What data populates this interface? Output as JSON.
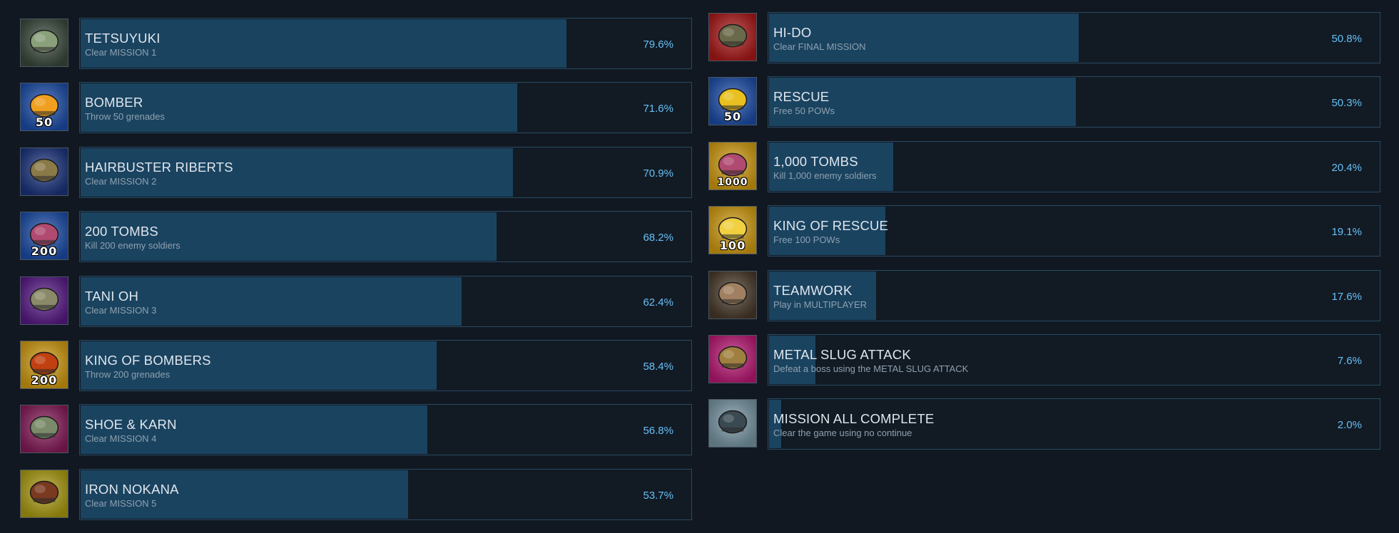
{
  "achievements_left": [
    {
      "name": "TETSUYUKI",
      "desc": "Clear MISSION 1",
      "pct_label": "79.6%",
      "pct": 79.6,
      "icon": "tetsuyuki-icon",
      "icon_bg": "#3a4a3c",
      "icon_fg": "#8aa07a"
    },
    {
      "name": "BOMBER",
      "desc": "Throw 50 grenades",
      "pct_label": "71.6%",
      "pct": 71.6,
      "icon": "bomber-50-icon",
      "icon_bg": "#1c4fae",
      "icon_fg": "#f0a020",
      "badge": "50"
    },
    {
      "name": "HAIRBUSTER RIBERTS",
      "desc": "Clear MISSION 2",
      "pct_label": "70.9%",
      "pct": 70.9,
      "icon": "hairbuster-riberts-icon",
      "icon_bg": "#1a3480",
      "icon_fg": "#8a7a48"
    },
    {
      "name": "200 TOMBS",
      "desc": "Kill 200 enemy soldiers",
      "pct_label": "68.2%",
      "pct": 68.2,
      "icon": "tombs-200-icon",
      "icon_bg": "#1c4fae",
      "icon_fg": "#b04a70",
      "badge": "200"
    },
    {
      "name": "TANI OH",
      "desc": "Clear MISSION 3",
      "pct_label": "62.4%",
      "pct": 62.4,
      "icon": "tani-oh-icon",
      "icon_bg": "#5a1a8a",
      "icon_fg": "#8a8a6a"
    },
    {
      "name": "KING OF BOMBERS",
      "desc": "Throw 200 grenades",
      "pct_label": "58.4%",
      "pct": 58.4,
      "icon": "king-of-bombers-icon",
      "icon_bg": "#d8a010",
      "icon_fg": "#c04010",
      "badge": "200"
    },
    {
      "name": "SHOE & KARN",
      "desc": "Clear MISSION 4",
      "pct_label": "56.8%",
      "pct": 56.8,
      "icon": "shoe-and-karn-icon",
      "icon_bg": "#8a1a5a",
      "icon_fg": "#7a8a6a"
    },
    {
      "name": "IRON NOKANA",
      "desc": "Clear MISSION 5",
      "pct_label": "53.7%",
      "pct": 53.7,
      "icon": "iron-nokana-icon",
      "icon_bg": "#b0a010",
      "icon_fg": "#7a3a20"
    }
  ],
  "achievements_right": [
    {
      "name": "HI-DO",
      "desc": "Clear FINAL MISSION",
      "pct_label": "50.8%",
      "pct": 50.8,
      "icon": "hi-do-icon",
      "icon_bg": "#b01818",
      "icon_fg": "#6a6a4a"
    },
    {
      "name": "RESCUE",
      "desc": "Free 50 POWs",
      "pct_label": "50.3%",
      "pct": 50.3,
      "icon": "rescue-50-icon",
      "icon_bg": "#1c4fae",
      "icon_fg": "#e8c020",
      "badge": "50"
    },
    {
      "name": "1,000 TOMBS",
      "desc": "Kill 1,000 enemy soldiers",
      "pct_label": "20.4%",
      "pct": 20.4,
      "icon": "tombs-1000-icon",
      "icon_bg": "#d8a010",
      "icon_fg": "#b04a70",
      "badge": "1000"
    },
    {
      "name": "KING OF RESCUE",
      "desc": "Free 100 POWs",
      "pct_label": "19.1%",
      "pct": 19.1,
      "icon": "king-of-rescue-icon",
      "icon_bg": "#d8a010",
      "icon_fg": "#f0d040",
      "badge": "100"
    },
    {
      "name": "TEAMWORK",
      "desc": "Play in MULTIPLAYER",
      "pct_label": "17.6%",
      "pct": 17.6,
      "icon": "teamwork-icon",
      "icon_bg": "#4a3a2a",
      "icon_fg": "#a08060"
    },
    {
      "name": "METAL SLUG ATTACK",
      "desc": "Defeat a boss using the METAL SLUG ATTACK",
      "pct_label": "7.6%",
      "pct": 7.6,
      "icon": "metal-slug-attack-icon",
      "icon_bg": "#c01878",
      "icon_fg": "#a08040"
    },
    {
      "name": "MISSION ALL COMPLETE",
      "desc": "Clear the game using no continue",
      "pct_label": "2.0%",
      "pct": 2.0,
      "icon": "mission-all-complete-icon",
      "icon_bg": "#7a9aa8",
      "icon_fg": "#3a4a52"
    }
  ]
}
